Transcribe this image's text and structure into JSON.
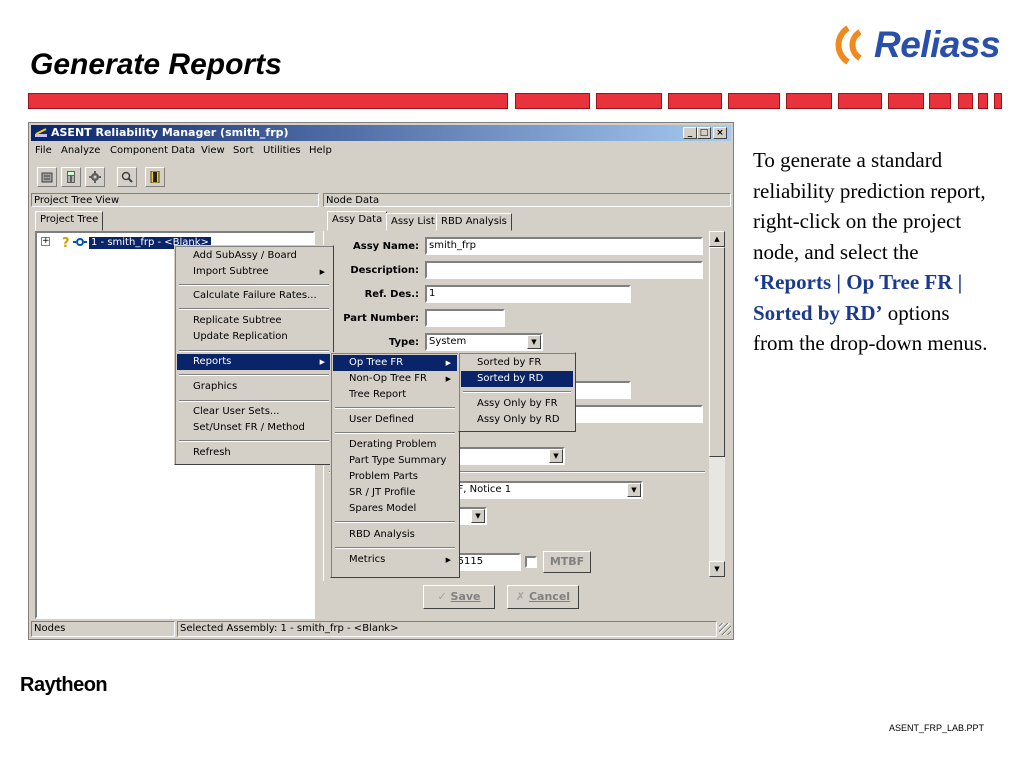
{
  "slide": {
    "title": "Generate Reports",
    "logo_text": "Reliass",
    "company": "Raytheon",
    "file": "ASENT_FRP_LAB.PPT",
    "notes": {
      "part1": "To generate a standard reliability prediction report, right-click on the project node, and select the ",
      "highlight": "‘Reports | Op Tree FR | Sorted by RD’",
      "part2": " options from the drop-down menus."
    }
  },
  "window": {
    "title": "ASENT Reliability Manager (smith_frp)",
    "controls": {
      "minimize": "_",
      "maximize": "□",
      "close": "×"
    },
    "menu": [
      "File",
      "Analyze",
      "Component Data",
      "View",
      "Sort",
      "Utilities",
      "Help"
    ],
    "toolbar_icons": [
      "project-icon",
      "calculator-icon",
      "gear-icon",
      "search-icon",
      "exit-door-icon"
    ]
  },
  "left_panel": {
    "header": "Project Tree View",
    "tab": "Project Tree",
    "tree_node": "1  -  smith_frp  -  <Blank>"
  },
  "right_panel": {
    "header": "Node Data",
    "tabs": [
      "Assy Data",
      "Assy List",
      "RBD Analysis"
    ],
    "fields": {
      "assy_name_label": "Assy Name:",
      "assy_name_value": "smith_frp",
      "description_label": "Description:",
      "description_value": "",
      "ref_des_label": "Ref. Des.:",
      "ref_des_value": "1",
      "part_number_label": "Part Number:",
      "part_number_value": "",
      "type_label": "Type:",
      "type_value": "System",
      "method_partial": "k-217F, Notice 1",
      "mtbf_value": "20.015115",
      "mtbf_button": "MTBF"
    },
    "buttons": {
      "save": "Save",
      "cancel": "Cancel"
    }
  },
  "status": {
    "nodes": "Nodes",
    "selected": "Selected Assembly: 1  -  smith_frp  -  <Blank>"
  },
  "context_menu": {
    "items": [
      {
        "label": "Add SubAssy / Board",
        "submenu": false
      },
      {
        "label": "Import Subtree",
        "submenu": true
      },
      {
        "label": "Calculate Failure Rates...",
        "submenu": false
      },
      {
        "label": "Replicate Subtree",
        "submenu": false
      },
      {
        "label": "Update Replication",
        "submenu": false
      },
      {
        "label": "Reports",
        "submenu": true
      },
      {
        "label": "Graphics",
        "submenu": false
      },
      {
        "label": "Clear User Sets...",
        "submenu": false
      },
      {
        "label": "Set/Unset FR / Method",
        "submenu": false
      },
      {
        "label": "Refresh",
        "submenu": false
      }
    ]
  },
  "reports_menu": {
    "items": [
      {
        "label": "Op Tree FR",
        "submenu": true
      },
      {
        "label": "Non-Op Tree FR",
        "submenu": true
      },
      {
        "label": "Tree Report",
        "submenu": false
      },
      {
        "label": "User Defined",
        "submenu": false
      },
      {
        "label": "Derating Problem",
        "submenu": false
      },
      {
        "label": "Part Type Summary",
        "submenu": false
      },
      {
        "label": "Problem Parts",
        "submenu": false
      },
      {
        "label": "SR / JT Profile",
        "submenu": false
      },
      {
        "label": "Spares Model",
        "submenu": false
      },
      {
        "label": "RBD Analysis",
        "submenu": false
      },
      {
        "label": "Metrics",
        "submenu": true
      }
    ]
  },
  "optree_menu": {
    "items": [
      "Sorted by FR",
      "Sorted by RD",
      "Assy Only by FR",
      "Assy Only by RD"
    ]
  },
  "colors": {
    "band_red": "#e8323c",
    "titlebar": "#0a246a",
    "highlight": "#0a246a",
    "notes_highlight": "#1a3a8f",
    "logo_blue": "#2a4fa8",
    "logo_orange": "#f08a1c"
  }
}
